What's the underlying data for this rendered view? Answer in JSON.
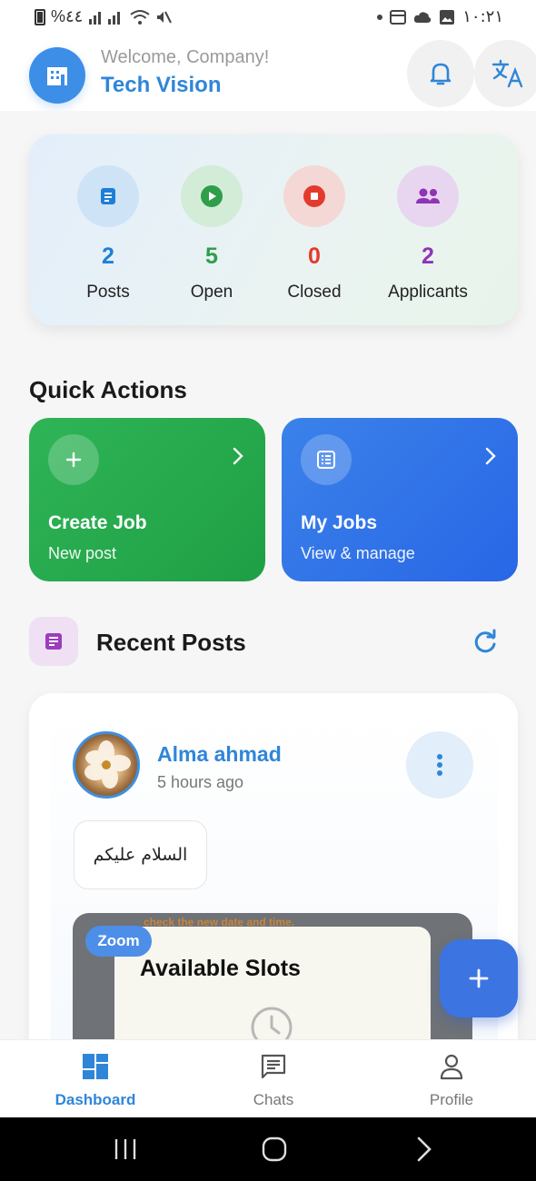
{
  "status_bar": {
    "left_text": "%٤٤",
    "clock": "١٠:٢١"
  },
  "header": {
    "welcome": "Welcome, Company!",
    "company_name": "Tech Vision"
  },
  "stats": [
    {
      "value": "2",
      "label": "Posts",
      "color": "#1e7fd6",
      "bg": "#cfe3f7"
    },
    {
      "value": "5",
      "label": "Open",
      "color": "#2e9e4a",
      "bg": "#d3ecd8"
    },
    {
      "value": "0",
      "label": "Closed",
      "color": "#e23b2e",
      "bg": "#f4d8d6"
    },
    {
      "value": "2",
      "label": "Applicants",
      "color": "#8e35b5",
      "bg": "#e8d6f1"
    }
  ],
  "quick_actions": {
    "title": "Quick Actions",
    "items": [
      {
        "name": "Create Job",
        "sub": "New post"
      },
      {
        "name": "My Jobs",
        "sub": "View & manage"
      }
    ]
  },
  "recent_posts": {
    "title": "Recent Posts",
    "post": {
      "author": "Alma ahmad",
      "time_ago": "5 hours ago",
      "message": "السلام عليكم",
      "image_top_text": "check the new date and time.",
      "image_heading": "Available Slots",
      "zoom_label": "Zoom"
    }
  },
  "bottom_nav": {
    "items": [
      {
        "label": "Dashboard",
        "active": true
      },
      {
        "label": "Chats",
        "active": false
      },
      {
        "label": "Profile",
        "active": false
      }
    ]
  },
  "colors": {
    "brand_blue": "#2f86d8",
    "create_green": "#22a64a",
    "myjobs_blue": "#2f6fe8"
  }
}
